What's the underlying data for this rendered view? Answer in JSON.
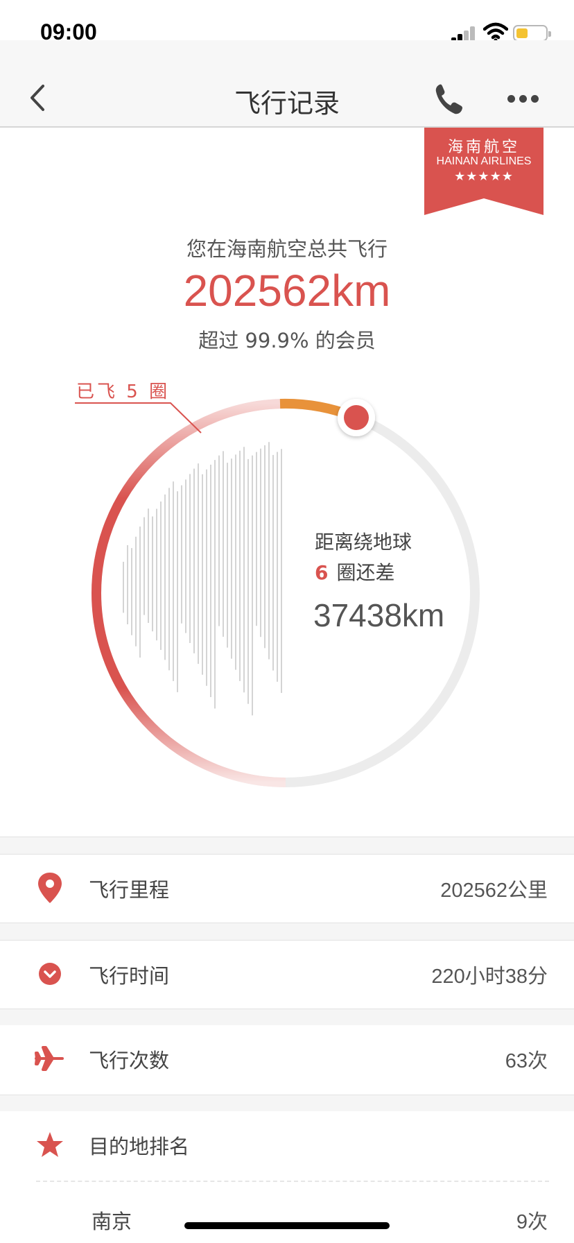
{
  "status_bar": {
    "time": "09:00"
  },
  "nav": {
    "title": "飞行记录"
  },
  "badge": {
    "name_cn": "海南航空",
    "name_en": "HAINAN AIRLINES",
    "stars": "★★★★★"
  },
  "summary": {
    "label": "您在海南航空总共飞行",
    "total_km": "202562km",
    "rank": "超过 99.9% 的会员"
  },
  "globe": {
    "laps_flown": "已飞 5 圈",
    "remain_title": "距离绕地球",
    "remain_laps_num": "6",
    "remain_laps_text": "圈还差",
    "remain_km": "37438km",
    "progress_color": "#d9534f",
    "remain_color": "#e8923a"
  },
  "stats": [
    {
      "label": "飞行里程",
      "value": "202562公里",
      "icon": "location-pin-icon"
    },
    {
      "label": "飞行时间",
      "value": "220小时38分",
      "icon": "clock-icon"
    },
    {
      "label": "飞行次数",
      "value": "63次",
      "icon": "airplane-icon"
    },
    {
      "label": "目的地排名",
      "value": "",
      "icon": "star-icon"
    }
  ],
  "destinations": [
    {
      "city": "南京",
      "count": "9次"
    }
  ],
  "colors": {
    "accent": "#d9534f",
    "badge": "#d9534f"
  }
}
